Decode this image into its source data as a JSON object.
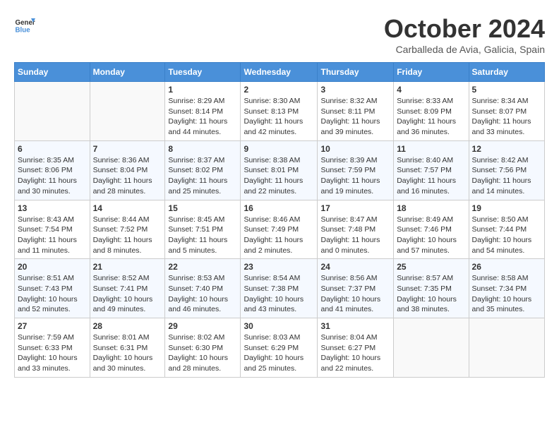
{
  "logo": {
    "line1": "General",
    "line2": "Blue"
  },
  "title": "October 2024",
  "location": "Carballeda de Avia, Galicia, Spain",
  "weekdays": [
    "Sunday",
    "Monday",
    "Tuesday",
    "Wednesday",
    "Thursday",
    "Friday",
    "Saturday"
  ],
  "weeks": [
    [
      {
        "day": "",
        "info": ""
      },
      {
        "day": "",
        "info": ""
      },
      {
        "day": "1",
        "sunrise": "8:29 AM",
        "sunset": "8:14 PM",
        "daylight": "11 hours and 44 minutes."
      },
      {
        "day": "2",
        "sunrise": "8:30 AM",
        "sunset": "8:13 PM",
        "daylight": "11 hours and 42 minutes."
      },
      {
        "day": "3",
        "sunrise": "8:32 AM",
        "sunset": "8:11 PM",
        "daylight": "11 hours and 39 minutes."
      },
      {
        "day": "4",
        "sunrise": "8:33 AM",
        "sunset": "8:09 PM",
        "daylight": "11 hours and 36 minutes."
      },
      {
        "day": "5",
        "sunrise": "8:34 AM",
        "sunset": "8:07 PM",
        "daylight": "11 hours and 33 minutes."
      }
    ],
    [
      {
        "day": "6",
        "sunrise": "8:35 AM",
        "sunset": "8:06 PM",
        "daylight": "11 hours and 30 minutes."
      },
      {
        "day": "7",
        "sunrise": "8:36 AM",
        "sunset": "8:04 PM",
        "daylight": "11 hours and 28 minutes."
      },
      {
        "day": "8",
        "sunrise": "8:37 AM",
        "sunset": "8:02 PM",
        "daylight": "11 hours and 25 minutes."
      },
      {
        "day": "9",
        "sunrise": "8:38 AM",
        "sunset": "8:01 PM",
        "daylight": "11 hours and 22 minutes."
      },
      {
        "day": "10",
        "sunrise": "8:39 AM",
        "sunset": "7:59 PM",
        "daylight": "11 hours and 19 minutes."
      },
      {
        "day": "11",
        "sunrise": "8:40 AM",
        "sunset": "7:57 PM",
        "daylight": "11 hours and 16 minutes."
      },
      {
        "day": "12",
        "sunrise": "8:42 AM",
        "sunset": "7:56 PM",
        "daylight": "11 hours and 14 minutes."
      }
    ],
    [
      {
        "day": "13",
        "sunrise": "8:43 AM",
        "sunset": "7:54 PM",
        "daylight": "11 hours and 11 minutes."
      },
      {
        "day": "14",
        "sunrise": "8:44 AM",
        "sunset": "7:52 PM",
        "daylight": "11 hours and 8 minutes."
      },
      {
        "day": "15",
        "sunrise": "8:45 AM",
        "sunset": "7:51 PM",
        "daylight": "11 hours and 5 minutes."
      },
      {
        "day": "16",
        "sunrise": "8:46 AM",
        "sunset": "7:49 PM",
        "daylight": "11 hours and 2 minutes."
      },
      {
        "day": "17",
        "sunrise": "8:47 AM",
        "sunset": "7:48 PM",
        "daylight": "11 hours and 0 minutes."
      },
      {
        "day": "18",
        "sunrise": "8:49 AM",
        "sunset": "7:46 PM",
        "daylight": "10 hours and 57 minutes."
      },
      {
        "day": "19",
        "sunrise": "8:50 AM",
        "sunset": "7:44 PM",
        "daylight": "10 hours and 54 minutes."
      }
    ],
    [
      {
        "day": "20",
        "sunrise": "8:51 AM",
        "sunset": "7:43 PM",
        "daylight": "10 hours and 52 minutes."
      },
      {
        "day": "21",
        "sunrise": "8:52 AM",
        "sunset": "7:41 PM",
        "daylight": "10 hours and 49 minutes."
      },
      {
        "day": "22",
        "sunrise": "8:53 AM",
        "sunset": "7:40 PM",
        "daylight": "10 hours and 46 minutes."
      },
      {
        "day": "23",
        "sunrise": "8:54 AM",
        "sunset": "7:38 PM",
        "daylight": "10 hours and 43 minutes."
      },
      {
        "day": "24",
        "sunrise": "8:56 AM",
        "sunset": "7:37 PM",
        "daylight": "10 hours and 41 minutes."
      },
      {
        "day": "25",
        "sunrise": "8:57 AM",
        "sunset": "7:35 PM",
        "daylight": "10 hours and 38 minutes."
      },
      {
        "day": "26",
        "sunrise": "8:58 AM",
        "sunset": "7:34 PM",
        "daylight": "10 hours and 35 minutes."
      }
    ],
    [
      {
        "day": "27",
        "sunrise": "7:59 AM",
        "sunset": "6:33 PM",
        "daylight": "10 hours and 33 minutes."
      },
      {
        "day": "28",
        "sunrise": "8:01 AM",
        "sunset": "6:31 PM",
        "daylight": "10 hours and 30 minutes."
      },
      {
        "day": "29",
        "sunrise": "8:02 AM",
        "sunset": "6:30 PM",
        "daylight": "10 hours and 28 minutes."
      },
      {
        "day": "30",
        "sunrise": "8:03 AM",
        "sunset": "6:29 PM",
        "daylight": "10 hours and 25 minutes."
      },
      {
        "day": "31",
        "sunrise": "8:04 AM",
        "sunset": "6:27 PM",
        "daylight": "10 hours and 22 minutes."
      },
      {
        "day": "",
        "info": ""
      },
      {
        "day": "",
        "info": ""
      }
    ]
  ]
}
